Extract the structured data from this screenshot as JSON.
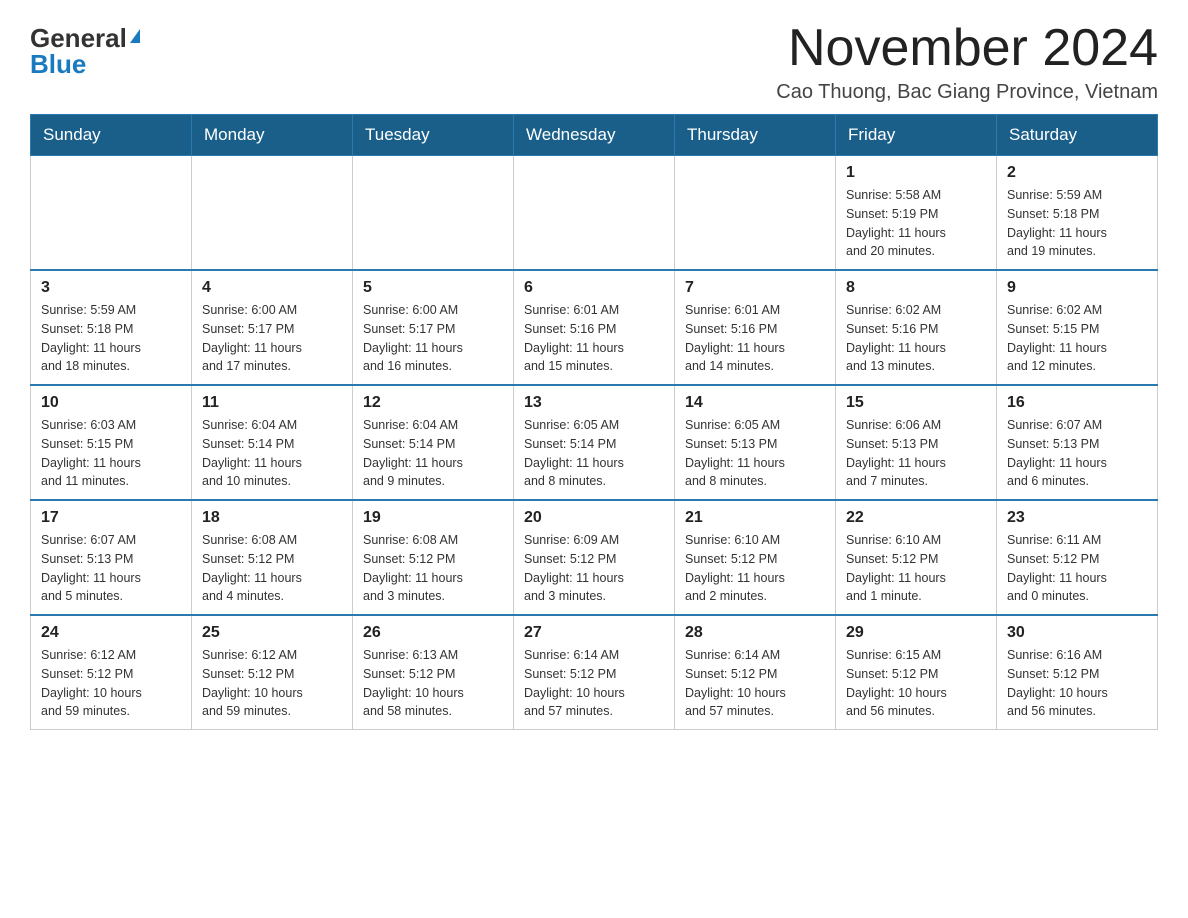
{
  "logo": {
    "general": "General",
    "blue": "Blue",
    "triangle": "▲"
  },
  "title": "November 2024",
  "subtitle": "Cao Thuong, Bac Giang Province, Vietnam",
  "days_of_week": [
    "Sunday",
    "Monday",
    "Tuesday",
    "Wednesday",
    "Thursday",
    "Friday",
    "Saturday"
  ],
  "weeks": [
    {
      "days": [
        {
          "number": "",
          "info": ""
        },
        {
          "number": "",
          "info": ""
        },
        {
          "number": "",
          "info": ""
        },
        {
          "number": "",
          "info": ""
        },
        {
          "number": "",
          "info": ""
        },
        {
          "number": "1",
          "info": "Sunrise: 5:58 AM\nSunset: 5:19 PM\nDaylight: 11 hours\nand 20 minutes."
        },
        {
          "number": "2",
          "info": "Sunrise: 5:59 AM\nSunset: 5:18 PM\nDaylight: 11 hours\nand 19 minutes."
        }
      ]
    },
    {
      "days": [
        {
          "number": "3",
          "info": "Sunrise: 5:59 AM\nSunset: 5:18 PM\nDaylight: 11 hours\nand 18 minutes."
        },
        {
          "number": "4",
          "info": "Sunrise: 6:00 AM\nSunset: 5:17 PM\nDaylight: 11 hours\nand 17 minutes."
        },
        {
          "number": "5",
          "info": "Sunrise: 6:00 AM\nSunset: 5:17 PM\nDaylight: 11 hours\nand 16 minutes."
        },
        {
          "number": "6",
          "info": "Sunrise: 6:01 AM\nSunset: 5:16 PM\nDaylight: 11 hours\nand 15 minutes."
        },
        {
          "number": "7",
          "info": "Sunrise: 6:01 AM\nSunset: 5:16 PM\nDaylight: 11 hours\nand 14 minutes."
        },
        {
          "number": "8",
          "info": "Sunrise: 6:02 AM\nSunset: 5:16 PM\nDaylight: 11 hours\nand 13 minutes."
        },
        {
          "number": "9",
          "info": "Sunrise: 6:02 AM\nSunset: 5:15 PM\nDaylight: 11 hours\nand 12 minutes."
        }
      ]
    },
    {
      "days": [
        {
          "number": "10",
          "info": "Sunrise: 6:03 AM\nSunset: 5:15 PM\nDaylight: 11 hours\nand 11 minutes."
        },
        {
          "number": "11",
          "info": "Sunrise: 6:04 AM\nSunset: 5:14 PM\nDaylight: 11 hours\nand 10 minutes."
        },
        {
          "number": "12",
          "info": "Sunrise: 6:04 AM\nSunset: 5:14 PM\nDaylight: 11 hours\nand 9 minutes."
        },
        {
          "number": "13",
          "info": "Sunrise: 6:05 AM\nSunset: 5:14 PM\nDaylight: 11 hours\nand 8 minutes."
        },
        {
          "number": "14",
          "info": "Sunrise: 6:05 AM\nSunset: 5:13 PM\nDaylight: 11 hours\nand 8 minutes."
        },
        {
          "number": "15",
          "info": "Sunrise: 6:06 AM\nSunset: 5:13 PM\nDaylight: 11 hours\nand 7 minutes."
        },
        {
          "number": "16",
          "info": "Sunrise: 6:07 AM\nSunset: 5:13 PM\nDaylight: 11 hours\nand 6 minutes."
        }
      ]
    },
    {
      "days": [
        {
          "number": "17",
          "info": "Sunrise: 6:07 AM\nSunset: 5:13 PM\nDaylight: 11 hours\nand 5 minutes."
        },
        {
          "number": "18",
          "info": "Sunrise: 6:08 AM\nSunset: 5:12 PM\nDaylight: 11 hours\nand 4 minutes."
        },
        {
          "number": "19",
          "info": "Sunrise: 6:08 AM\nSunset: 5:12 PM\nDaylight: 11 hours\nand 3 minutes."
        },
        {
          "number": "20",
          "info": "Sunrise: 6:09 AM\nSunset: 5:12 PM\nDaylight: 11 hours\nand 3 minutes."
        },
        {
          "number": "21",
          "info": "Sunrise: 6:10 AM\nSunset: 5:12 PM\nDaylight: 11 hours\nand 2 minutes."
        },
        {
          "number": "22",
          "info": "Sunrise: 6:10 AM\nSunset: 5:12 PM\nDaylight: 11 hours\nand 1 minute."
        },
        {
          "number": "23",
          "info": "Sunrise: 6:11 AM\nSunset: 5:12 PM\nDaylight: 11 hours\nand 0 minutes."
        }
      ]
    },
    {
      "days": [
        {
          "number": "24",
          "info": "Sunrise: 6:12 AM\nSunset: 5:12 PM\nDaylight: 10 hours\nand 59 minutes."
        },
        {
          "number": "25",
          "info": "Sunrise: 6:12 AM\nSunset: 5:12 PM\nDaylight: 10 hours\nand 59 minutes."
        },
        {
          "number": "26",
          "info": "Sunrise: 6:13 AM\nSunset: 5:12 PM\nDaylight: 10 hours\nand 58 minutes."
        },
        {
          "number": "27",
          "info": "Sunrise: 6:14 AM\nSunset: 5:12 PM\nDaylight: 10 hours\nand 57 minutes."
        },
        {
          "number": "28",
          "info": "Sunrise: 6:14 AM\nSunset: 5:12 PM\nDaylight: 10 hours\nand 57 minutes."
        },
        {
          "number": "29",
          "info": "Sunrise: 6:15 AM\nSunset: 5:12 PM\nDaylight: 10 hours\nand 56 minutes."
        },
        {
          "number": "30",
          "info": "Sunrise: 6:16 AM\nSunset: 5:12 PM\nDaylight: 10 hours\nand 56 minutes."
        }
      ]
    }
  ]
}
